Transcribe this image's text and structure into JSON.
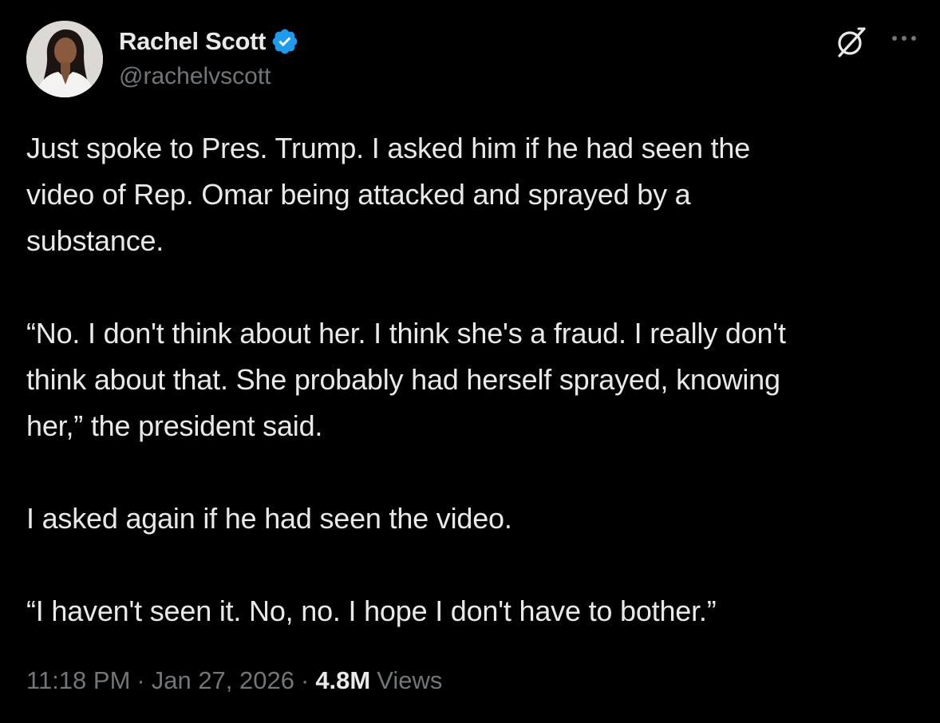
{
  "author": {
    "display_name": "Rachel Scott",
    "handle": "@rachelvscott",
    "verified": true,
    "avatar_icon": "profile-photo"
  },
  "actions": {
    "grok_icon": "grok-icon",
    "more_icon": "more-options-icon"
  },
  "tweet": {
    "paragraphs": [
      "Just spoke to Pres. Trump. I asked him if he had seen the\nvideo of Rep. Omar being attacked and sprayed by a\nsubstance.",
      "“No. I don't think about her. I think she's a fraud. I really don't\nthink about that. She probably had herself sprayed, knowing\nher,” the president said.",
      "I asked again if he had seen the video.",
      "“I haven't seen it. No, no. I hope I don't have to bother.”"
    ]
  },
  "meta": {
    "time": "11:18 PM",
    "separator": "·",
    "date": "Jan 27, 2026",
    "views_count": "4.8M",
    "views_label": "Views"
  },
  "colors": {
    "background": "#000000",
    "primary_text": "#e7e9ea",
    "secondary_text": "#71767b",
    "verified_blue": "#1d9bf0"
  }
}
